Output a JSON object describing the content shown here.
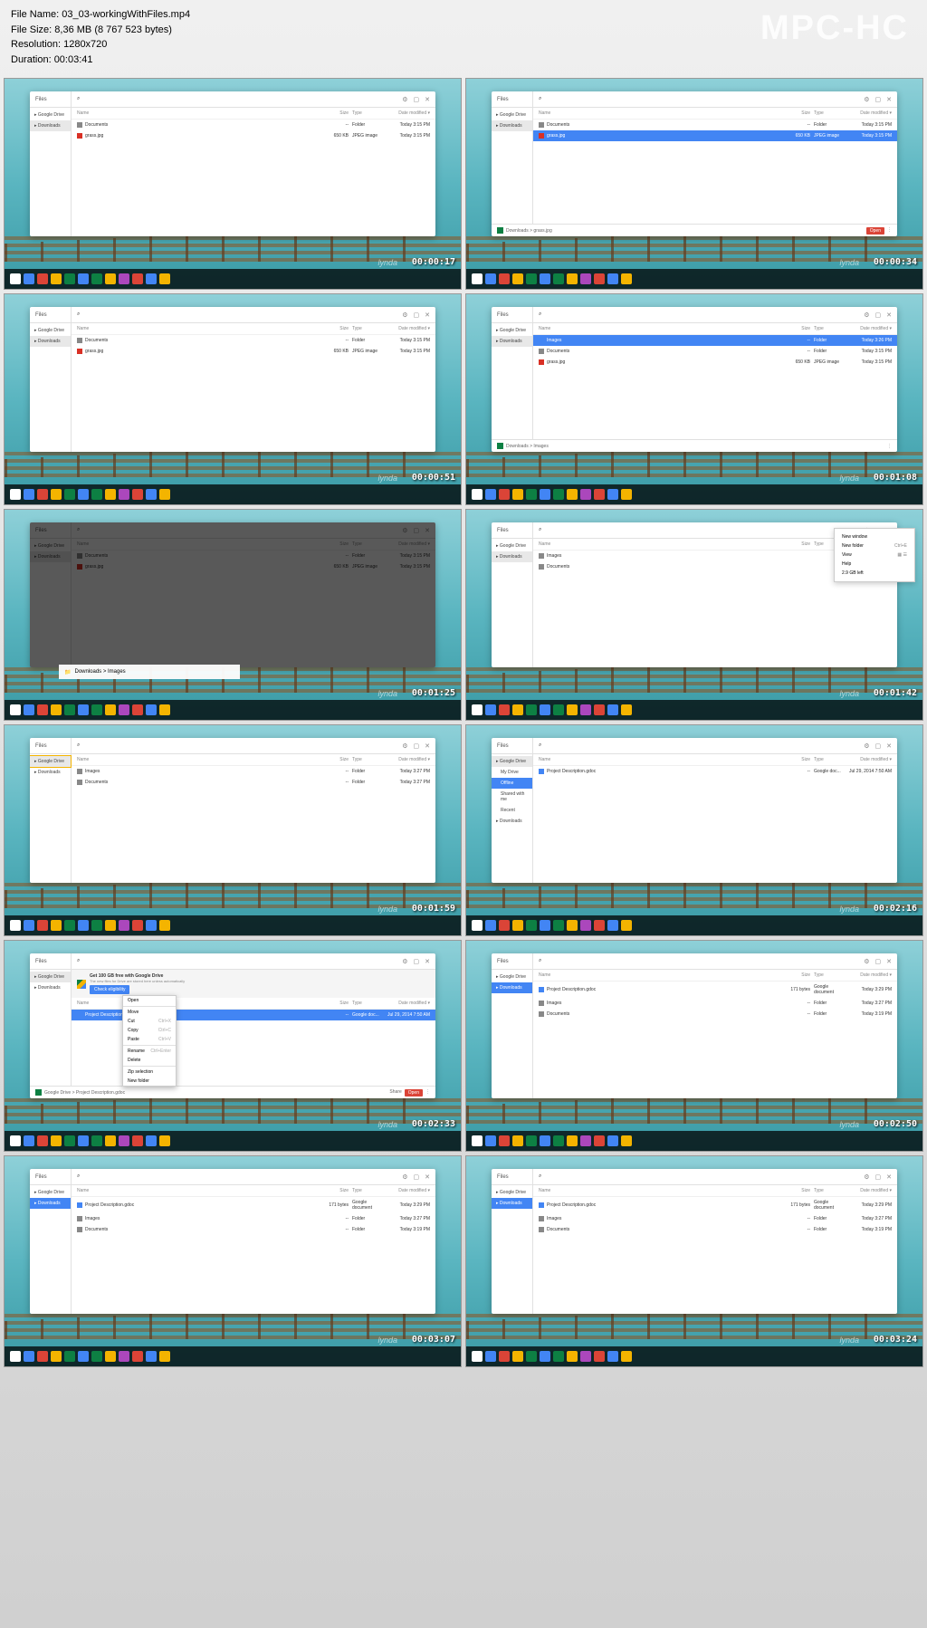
{
  "header": {
    "filename_label": "File Name: 03_03-workingWithFiles.mp4",
    "filesize_label": "File Size: 8,36 MB (8 767 523 bytes)",
    "resolution_label": "Resolution: 1280x720",
    "duration_label": "Duration: 00:03:41"
  },
  "watermark": "MPC-HC",
  "lynda": "lynda",
  "shelf_colors": [
    "#fff",
    "#4285f4",
    "#db4437",
    "#f4b400",
    "#0d8043",
    "#4285f4",
    "#0d8043",
    "#f4b400",
    "#ab47bc",
    "#db4437",
    "#4285f4",
    "#f4b400"
  ],
  "common": {
    "files_title": "Files",
    "sidebar_drive": "Google Drive",
    "sidebar_downloads": "Downloads",
    "col_name": "Name",
    "col_size": "Size",
    "col_type": "Type",
    "col_date": "Date modified",
    "search_icon": "⌕",
    "gear_icon": "⚙",
    "min_icon": "▢",
    "close_icon": "✕"
  },
  "frames": [
    {
      "ts": "00:00:17",
      "side_sel": "Downloads",
      "rows": [
        {
          "icon": "folder",
          "name": "Documents",
          "size": "--",
          "type": "Folder",
          "date": "Today 3:15 PM"
        },
        {
          "icon": "img",
          "name": "grass.jpg",
          "size": "650 KB",
          "type": "JPEG image",
          "date": "Today 3:15 PM"
        }
      ]
    },
    {
      "ts": "00:00:34",
      "side_sel": "Downloads",
      "rows": [
        {
          "icon": "folder",
          "name": "Documents",
          "size": "--",
          "type": "Folder",
          "date": "Today 3:15 PM"
        },
        {
          "icon": "img",
          "name": "grass.jpg",
          "size": "650 KB",
          "type": "JPEG image",
          "date": "Today 3:15 PM",
          "sel": true
        }
      ],
      "status": {
        "crumb": "Downloads > grass.jpg",
        "open": "Open"
      }
    },
    {
      "ts": "00:00:51",
      "side_sel": "Downloads",
      "rows": [
        {
          "icon": "folder",
          "name": "Documents",
          "size": "--",
          "type": "Folder",
          "date": "Today 3:15 PM"
        },
        {
          "icon": "img",
          "name": "grass.jpg",
          "size": "650 KB",
          "type": "JPEG image",
          "date": "Today 3:15 PM"
        }
      ]
    },
    {
      "ts": "00:01:08",
      "side_sel": "Downloads",
      "rows": [
        {
          "icon": "folder-b",
          "name": "Images",
          "size": "--",
          "type": "Folder",
          "date": "Today 3:26 PM",
          "sel": true
        },
        {
          "icon": "folder",
          "name": "Documents",
          "size": "--",
          "type": "Folder",
          "date": "Today 3:15 PM"
        },
        {
          "icon": "img",
          "name": "grass.jpg",
          "size": "650 KB",
          "type": "JPEG image",
          "date": "Today 3:15 PM"
        }
      ],
      "status": {
        "crumb": "Downloads > Images"
      }
    },
    {
      "ts": "00:01:25",
      "dim": true,
      "side_sel": "Downloads",
      "rows": [
        {
          "icon": "folder",
          "name": "Documents",
          "size": "--",
          "type": "Folder",
          "date": "Today 3:15 PM"
        },
        {
          "icon": "img",
          "name": "grass.jpg",
          "size": "650 KB",
          "type": "JPEG image",
          "date": "Today 3:15 PM"
        }
      ],
      "overlay": {
        "crumb": "Downloads > Images"
      }
    },
    {
      "ts": "00:01:42",
      "side_sel": "Downloads",
      "rows": [
        {
          "icon": "folder",
          "name": "Images",
          "size": "",
          "type": "",
          "date": ""
        },
        {
          "icon": "folder",
          "name": "Documents",
          "size": "",
          "type": "",
          "date": ""
        }
      ],
      "popup": {
        "items": [
          {
            "l": "New window",
            "r": ""
          },
          {
            "l": "New folder",
            "r": "Ctrl+E"
          },
          {
            "l": "View",
            "r": "▦ ☰"
          },
          {
            "l": "Help",
            "r": ""
          },
          {
            "l": "2.9 GB left",
            "r": ""
          }
        ]
      }
    },
    {
      "ts": "00:01:59",
      "side_sel": "Google Drive",
      "highlight": true,
      "rows": [
        {
          "icon": "folder",
          "name": "Images",
          "size": "--",
          "type": "Folder",
          "date": "Today 3:27 PM"
        },
        {
          "icon": "folder",
          "name": "Documents",
          "size": "--",
          "type": "Folder",
          "date": "Today 3:27 PM"
        }
      ]
    },
    {
      "ts": "00:02:16",
      "side": "drive",
      "sub": [
        {
          "l": "My Drive"
        },
        {
          "l": "Offline",
          "sel": true
        },
        {
          "l": "Shared with me"
        },
        {
          "l": "Recent"
        }
      ],
      "rows": [
        {
          "icon": "doc",
          "name": "Project Description.gdoc",
          "size": "--",
          "type": "Google doc...",
          "date": "Jul 29, 2014 7:50 AM"
        }
      ]
    },
    {
      "ts": "00:02:33",
      "side": "drive",
      "promo": {
        "title": "Get 100 GB free with Google Drive",
        "sub": "The new files for Drive are stored here unless automatically",
        "btn": "Check eligibility"
      },
      "rows": [
        {
          "icon": "doc",
          "name": "Project Description.gdoc",
          "size": "--",
          "type": "Google doc...",
          "date": "Jul 29, 2014 7:50 AM",
          "sel": true
        }
      ],
      "ctx": {
        "items": [
          {
            "l": "Open",
            "r": ""
          },
          {
            "l": "Move",
            "r": ""
          },
          {
            "l": "Cut",
            "r": "Ctrl+X"
          },
          {
            "l": "Copy",
            "r": "Ctrl+C"
          },
          {
            "l": "Paste",
            "r": "Ctrl+V"
          },
          {
            "l": "Rename",
            "r": "Ctrl+Enter"
          },
          {
            "l": "Delete",
            "r": ""
          },
          {
            "l": "Zip selection",
            "r": ""
          },
          {
            "l": "New folder",
            "r": ""
          }
        ]
      },
      "status": {
        "crumb": "Google Drive > Project Description.gdoc",
        "share": "Share",
        "open": "Open"
      }
    },
    {
      "ts": "00:02:50",
      "side_sel": "Downloads",
      "side_blue": true,
      "rows": [
        {
          "icon": "doc",
          "name": "Project Description.gdoc",
          "size": "171 bytes",
          "type": "Google document",
          "date": "Today 3:29 PM"
        },
        {
          "icon": "folder",
          "name": "Images",
          "size": "--",
          "type": "Folder",
          "date": "Today 3:27 PM"
        },
        {
          "icon": "folder",
          "name": "Documents",
          "size": "--",
          "type": "Folder",
          "date": "Today 3:19 PM"
        }
      ]
    },
    {
      "ts": "00:03:07",
      "side_sel": "Downloads",
      "side_blue": true,
      "rows": [
        {
          "icon": "doc",
          "name": "Project Description.gdoc",
          "size": "171 bytes",
          "type": "Google document",
          "date": "Today 3:29 PM"
        },
        {
          "icon": "folder",
          "name": "Images",
          "size": "--",
          "type": "Folder",
          "date": "Today 3:27 PM"
        },
        {
          "icon": "folder",
          "name": "Documents",
          "size": "--",
          "type": "Folder",
          "date": "Today 3:19 PM"
        }
      ]
    },
    {
      "ts": "00:03:24",
      "side_sel": "Downloads",
      "side_blue": true,
      "rows": [
        {
          "icon": "doc",
          "name": "Project Description.gdoc",
          "size": "171 bytes",
          "type": "Google document",
          "date": "Today 3:29 PM"
        },
        {
          "icon": "folder",
          "name": "Images",
          "size": "--",
          "type": "Folder",
          "date": "Today 3:27 PM"
        },
        {
          "icon": "folder",
          "name": "Documents",
          "size": "--",
          "type": "Folder",
          "date": "Today 3:19 PM"
        }
      ]
    }
  ]
}
